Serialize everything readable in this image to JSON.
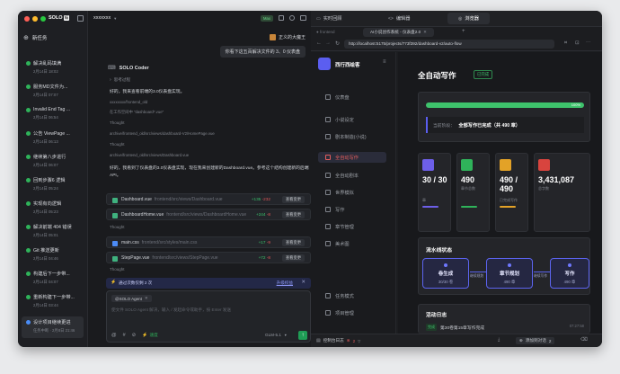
{
  "sidebar": {
    "logo": "SOLO",
    "logo_tag": "编",
    "new_task": "新任务",
    "items": [
      {
        "title": "解决乱码填满",
        "time": "2月14日 18:02"
      },
      {
        "title": "服务MD文件为...",
        "time": "2月14日 07:07"
      },
      {
        "title": "Invalid End Tag ...",
        "time": "2月14日 06:54"
      },
      {
        "title": "公告 ViewPage ...",
        "time": "2月14日 06:13"
      },
      {
        "title": "继续第八步进行",
        "time": "2月14日 06:07"
      },
      {
        "title": "回到步骤6 逻辑",
        "time": "2月14日 05:24"
      },
      {
        "title": "实现有向逻辑",
        "time": "2月14日 05:23"
      },
      {
        "title": "解决前端 404 错误",
        "time": "2月14日 05:01"
      },
      {
        "title": "Git 推送更新",
        "time": "2月14日 04:46"
      },
      {
        "title": "构建后下一步带...",
        "time": "2月14日 04:07"
      },
      {
        "title": "重新构建下一步带...",
        "time": "2月14日 03:44"
      },
      {
        "title": "设计项目继续更进",
        "time": "任务中断 · 2月8日 21:46"
      }
    ]
  },
  "chat": {
    "project": "xxxxxxx",
    "mode_badge": "Max",
    "user_name": "正义的大魔王",
    "user_msg": "你看下这五百解决文件的 3、0 仪表盘",
    "agent_name": "SOLO Coder",
    "thinking": "思考过程",
    "intro": "好的，我来查看前端的3.0仪表盘实现。",
    "search1": "xxxxxxxx/frontend_old",
    "search2": "在工作空间中 \"dashboard*.vue\"",
    "thought1": "Thought",
    "read1": "archive/frontend_old/src/views/dashboard-V2/HomePage.vue",
    "thought2": "Thought",
    "read2": "archive/frontend_old/src/views/Dashboard.vue",
    "summary": "好的，我看到了仪表盘的3.0仪表盘实现，现在我来创建新的Dashboard.vue。参考这个结构创建新的后端API。",
    "files": [
      {
        "name": "Dashboard.vue",
        "path": "frontend/src/views/Dashboard.vue",
        "add": "+135",
        "del": "-232",
        "btn": "查看变更"
      },
      {
        "name": "DashboardHome.vue",
        "path": "frontend/src/views/DashboardHome.vue",
        "add": "+244",
        "del": "-8",
        "btn": "查看变更"
      },
      {
        "name": "main.css",
        "path": "frontend/src/styles/main.css",
        "add": "+17",
        "del": "-9",
        "btn": "查看变更"
      },
      {
        "name": "StepPage.vue",
        "path": "frontend/src/views/StepPage.vue",
        "add": "+72",
        "del": "-8",
        "btn": "查看变更"
      }
    ],
    "thought3": "Thought",
    "thought4": "Thought",
    "notice": "通过次数仅剩 2 次",
    "notice_link": "升级权益",
    "input_tag": "@SOLO Agent",
    "input_placeholder": "使文件 SOLO Agent 解决，输入 / 发起命令或助手，按 Enter 发送",
    "mode": "速度",
    "model": "GLM-5.1"
  },
  "browser": {
    "tabs": [
      "实时回顾",
      "编辑器",
      "浏览器"
    ],
    "page_tab": "AI小说创作系统 - 仪表盘2.0",
    "url": "http://localhost:5175/projects/773f392/dashboard-v2/auto-flow",
    "app_name": "西行西绘客",
    "nav": [
      "仪表盘",
      "小说设定",
      "剧本制造(小说)",
      "全自动写作",
      "全自动剧本",
      "世界模拟",
      "写作",
      "章节管理",
      "美术图"
    ],
    "nav_bottom": [
      "任务模式",
      "项目管理"
    ],
    "page_title": "全自动写作",
    "status_tag": "已完成",
    "progress": 1.0,
    "progress_pct": "100%",
    "status_label": "当前阶段：",
    "status_text": "全部写作已完成（共 490 章）",
    "stats": [
      {
        "value": "30 / 30",
        "label": "章",
        "color": "#6d5fe8"
      },
      {
        "value": "490",
        "label": "章节总数",
        "color": "#2fb35a"
      },
      {
        "value": "490 / 490",
        "label": "已完成写作",
        "color": "#e3a227"
      },
      {
        "value": "3,431,087",
        "label": "总字数",
        "color": "#d8443e"
      }
    ],
    "pipeline_title": "流水线状态",
    "pipeline": [
      {
        "name": "卷生成",
        "count": "30/30 卷"
      },
      {
        "name": "章节规划",
        "count": "490 章"
      },
      {
        "name": "写作",
        "count": "490 章"
      }
    ],
    "pipeline_links": [
      "继续规划",
      "继续写作"
    ],
    "log_title": "活动日志",
    "log_tag": "完成",
    "log_text": "第30卷第15章写作完成",
    "log_time": "07:27:58",
    "footer_left": "控制台日志",
    "footer_count": "2",
    "footer_right": "添加到对话",
    "footer_num": "2"
  }
}
